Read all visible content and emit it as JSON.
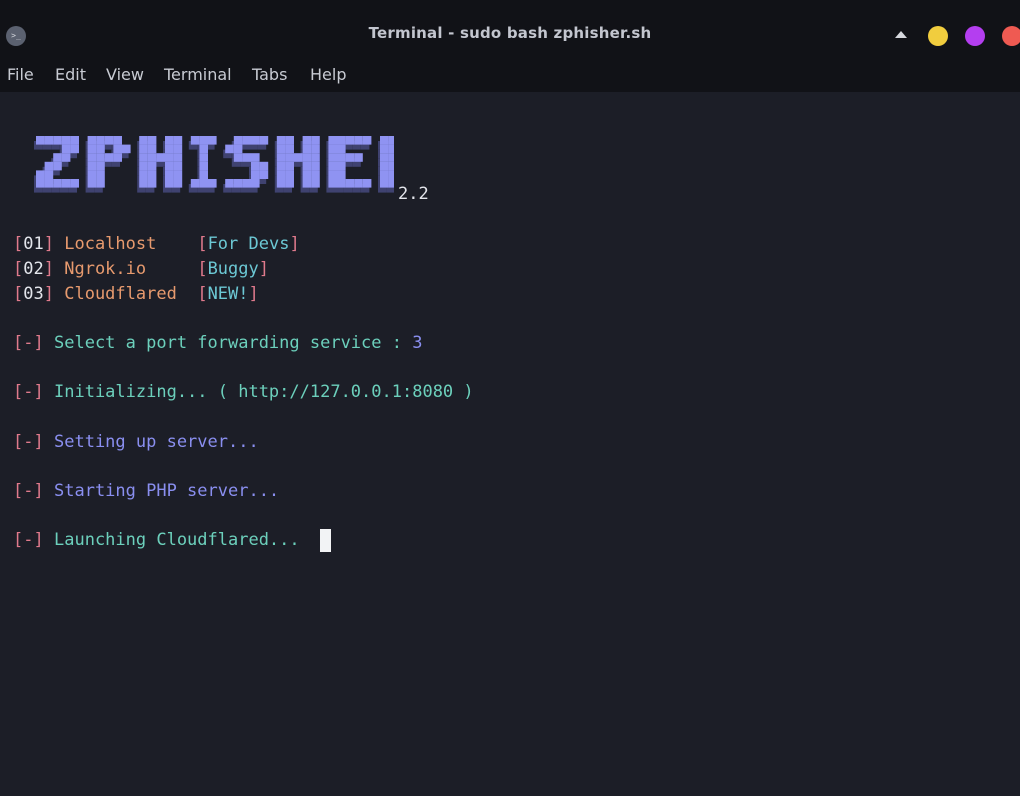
{
  "window": {
    "title": "Terminal - sudo bash zphisher.sh",
    "app_icon_glyph": ">_",
    "app_icon": "terminal-icon",
    "controls": [
      {
        "name": "minimize",
        "color": "#f1cd3e"
      },
      {
        "name": "maximize",
        "color": "#b43ef0"
      },
      {
        "name": "close",
        "color": "#ef5a52"
      }
    ]
  },
  "menu": [
    "File",
    "Edit",
    "View",
    "Terminal",
    "Tabs",
    "Help"
  ],
  "banner": {
    "logo_text": "ZPHISHER",
    "version": "2.2",
    "logo_color": "#8f93f2"
  },
  "options": [
    {
      "num": "01",
      "name": "Localhost",
      "tag": "For Devs"
    },
    {
      "num": "02",
      "name": "Ngrok.io",
      "tag": "Buggy"
    },
    {
      "num": "03",
      "name": "Cloudflared",
      "tag": "NEW!"
    }
  ],
  "messages": [
    {
      "prefix": "-",
      "text": "Select a port forwarding service : ",
      "value": "3"
    },
    {
      "prefix": "-",
      "text": "Initializing... ( http://127.0.0.1:8080 )"
    },
    {
      "prefix": "-",
      "text": "Setting up server..."
    },
    {
      "prefix": "-",
      "text": "Starting PHP server..."
    },
    {
      "prefix": "-",
      "text": "Launching Cloudflared..."
    }
  ]
}
